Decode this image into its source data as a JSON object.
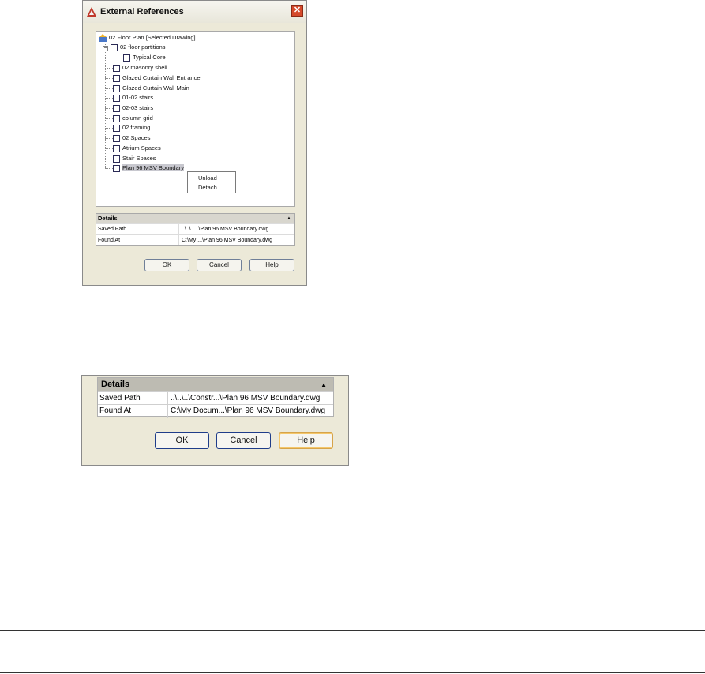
{
  "dialog1": {
    "title": "External References",
    "tree": {
      "root": "02 Floor Plan [Selected Drawing]",
      "items": [
        "02 floor partitions",
        "Typical Core",
        "02 masonry shell",
        "Glazed Curtain Wall Entrance",
        "Glazed Curtain Wall Main",
        "01-02 stairs",
        "02-03 stairs",
        "column grid",
        "02 framing",
        "02 Spaces",
        "Atrium Spaces",
        "Stair Spaces",
        "Plan 96 MSV Boundary"
      ]
    },
    "context_menu": {
      "unload": "Unload",
      "detach": "Detach"
    },
    "details": {
      "header": "Details",
      "saved_path_label": "Saved Path",
      "saved_path_value": "..\\..\\.....\\Plan 96 MSV Boundary.dwg",
      "found_at_label": "Found At",
      "found_at_value": "C:\\My ...\\Plan 96 MSV Boundary.dwg"
    },
    "buttons": {
      "ok": "OK",
      "cancel": "Cancel",
      "help": "Help"
    }
  },
  "dialog2": {
    "details": {
      "header": "Details",
      "saved_path_label": "Saved Path",
      "saved_path_value": "..\\..\\..\\Constr...\\Plan 96 MSV Boundary.dwg",
      "found_at_label": "Found At",
      "found_at_value": "C:\\My Docum...\\Plan 96 MSV Boundary.dwg"
    },
    "buttons": {
      "ok": "OK",
      "cancel": "Cancel",
      "help": "Help"
    }
  }
}
